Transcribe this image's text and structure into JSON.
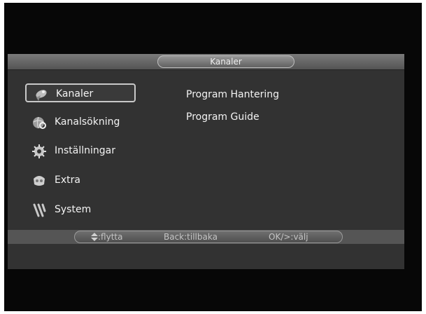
{
  "header": {
    "title": "Kanaler"
  },
  "menu": {
    "items": [
      {
        "label": "Kanaler",
        "icon": "satellite-dish-icon",
        "selected": true
      },
      {
        "label": "Kanalsökning",
        "icon": "globe-search-icon",
        "selected": false
      },
      {
        "label": "Inställningar",
        "icon": "gear-settings-icon",
        "selected": false
      },
      {
        "label": "Extra",
        "icon": "game-controller-icon",
        "selected": false
      },
      {
        "label": "System",
        "icon": "tools-icon",
        "selected": false
      }
    ]
  },
  "submenu": {
    "items": [
      {
        "label": "Program Hantering"
      },
      {
        "label": "Program Guide"
      }
    ]
  },
  "help": {
    "move_icon": "up-down-arrows-icon",
    "move_label": ":flytta",
    "back_label": "Back:tillbaka",
    "ok_label": "OK/>:välj"
  },
  "colors": {
    "background": "#070707",
    "panel": "#323232",
    "text": "#f3f3f3",
    "muted_text": "#c4c4c4",
    "selection_border": "#c9c9c9"
  }
}
